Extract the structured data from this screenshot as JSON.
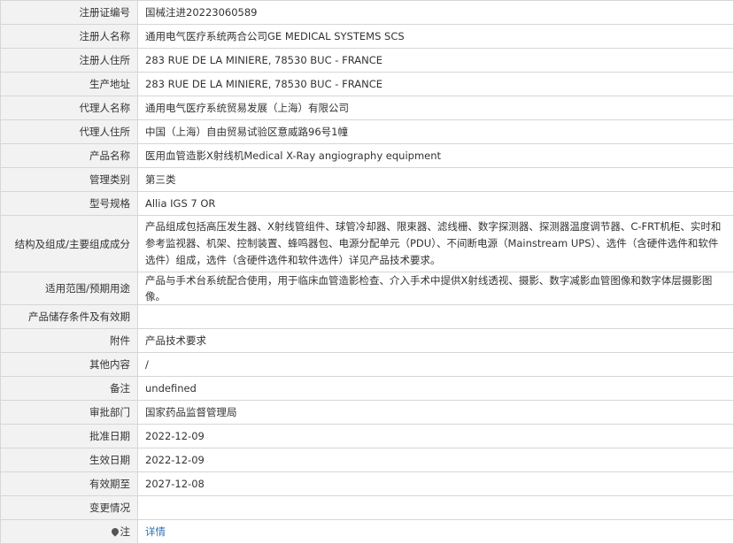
{
  "rows": [
    {
      "label": "注册证编号",
      "value": "国械注进20223060589"
    },
    {
      "label": "注册人名称",
      "value": "通用电气医疗系统两合公司GE MEDICAL SYSTEMS SCS"
    },
    {
      "label": "注册人住所",
      "value": "283 RUE DE LA MINIERE, 78530 BUC - FRANCE"
    },
    {
      "label": "生产地址",
      "value": "283 RUE DE LA MINIERE, 78530 BUC - FRANCE"
    },
    {
      "label": "代理人名称",
      "value": "通用电气医疗系统贸易发展（上海）有限公司"
    },
    {
      "label": "代理人住所",
      "value": "中国（上海）自由贸易试验区意威路96号1幢"
    },
    {
      "label": "产品名称",
      "value": "医用血管造影X射线机Medical X-Ray angiography equipment"
    },
    {
      "label": "管理类别",
      "value": "第三类"
    },
    {
      "label": "型号规格",
      "value": "Allia IGS 7 OR"
    },
    {
      "label": "结构及组成/主要组成成分",
      "value": "产品组成包括高压发生器、X射线管组件、球管冷却器、限束器、滤线栅、数字探测器、探测器温度调节器、C-FRT机柜、实时和参考监视器、机架、控制装置、蜂鸣器包、电源分配单元（PDU）、不间断电源（Mainstream UPS）、选件（含硬件选件和软件选件）组成，选件（含硬件选件和软件选件）详见产品技术要求。"
    },
    {
      "label": "适用范围/预期用途",
      "value": "产品与手术台系统配合使用，用于临床血管造影检查、介入手术中提供X射线透视、摄影、数字减影血管图像和数字体层摄影图像。"
    },
    {
      "label": "产品储存条件及有效期",
      "value": ""
    },
    {
      "label": "附件",
      "value": "产品技术要求"
    },
    {
      "label": "其他内容",
      "value": "/"
    },
    {
      "label": "备注",
      "value": "undefined"
    },
    {
      "label": "审批部门",
      "value": "国家药品监督管理局"
    },
    {
      "label": "批准日期",
      "value": "2022-12-09"
    },
    {
      "label": "生效日期",
      "value": "2022-12-09"
    },
    {
      "label": "有效期至",
      "value": "2027-12-08"
    },
    {
      "label": "变更情况",
      "value": ""
    },
    {
      "label": "注",
      "value": "详情"
    }
  ],
  "colors": {
    "label_bg": "#f2f2f2",
    "border": "#d6d6d6",
    "link": "#2a6fb0"
  },
  "icons": {
    "note": "pin-icon"
  }
}
